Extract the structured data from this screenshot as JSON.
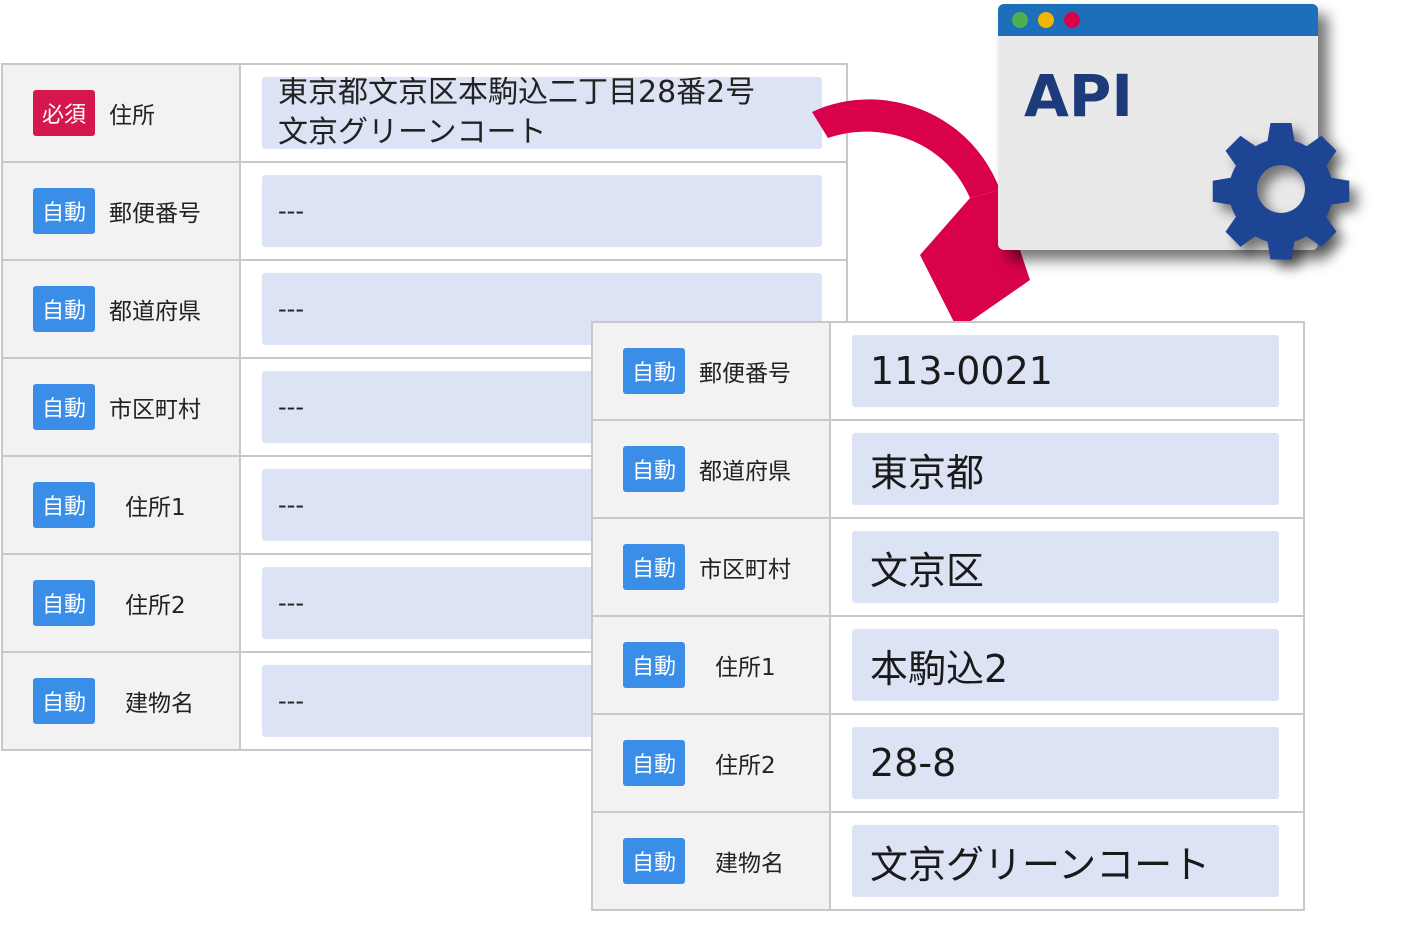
{
  "colors": {
    "badge_required": "#d6174e",
    "badge_auto": "#3a8ee8",
    "field_fill": "#dbe3f4",
    "api_blue": "#1d3a7a",
    "titlebar": "#1e6fba",
    "arrow": "#d9004c"
  },
  "left_form": {
    "rows": [
      {
        "badge": "必須",
        "label": "住所",
        "value_lines": [
          "東京都文京区本駒込二丁目28番2号",
          "文京グリーンコート"
        ]
      },
      {
        "badge": "自動",
        "label": "郵便番号",
        "value": "---"
      },
      {
        "badge": "自動",
        "label": "都道府県",
        "value": "---"
      },
      {
        "badge": "自動",
        "label": "市区町村",
        "value": "---"
      },
      {
        "badge": "自動",
        "label": "住所1",
        "value": "---"
      },
      {
        "badge": "自動",
        "label": "住所2",
        "value": "---"
      },
      {
        "badge": "自動",
        "label": "建物名",
        "value": "---"
      }
    ]
  },
  "right_form": {
    "rows": [
      {
        "badge": "自動",
        "label": "郵便番号",
        "value": "113-0021"
      },
      {
        "badge": "自動",
        "label": "都道府県",
        "value": "東京都"
      },
      {
        "badge": "自動",
        "label": "市区町村",
        "value": "文京区"
      },
      {
        "badge": "自動",
        "label": "住所1",
        "value": "本駒込2"
      },
      {
        "badge": "自動",
        "label": "住所2",
        "value": "28-8"
      },
      {
        "badge": "自動",
        "label": "建物名",
        "value": "文京グリーンコート"
      }
    ]
  },
  "api_window": {
    "title": "API",
    "dots": [
      "#4caf50",
      "#f2b600",
      "#d9004c"
    ],
    "icon": "gear-icon"
  },
  "arrow_icon": "curved-arrow-icon"
}
